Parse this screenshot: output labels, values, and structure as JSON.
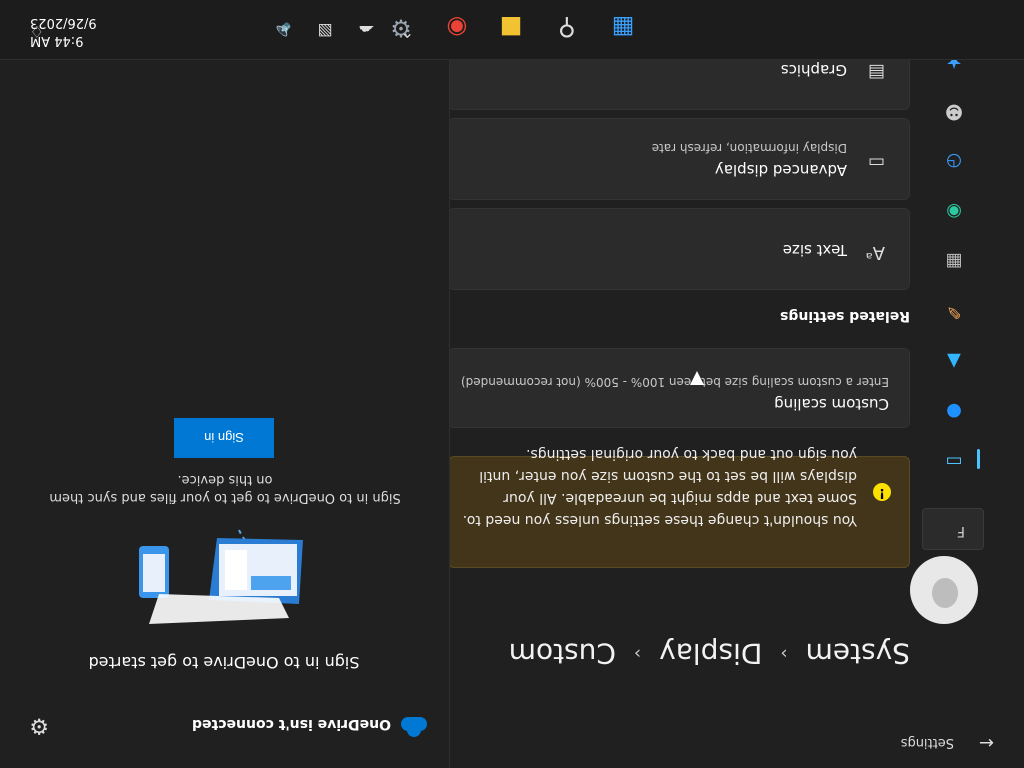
{
  "settings": {
    "window_title": "Settings",
    "back_icon": "back-arrow-icon",
    "find_label": "F",
    "breadcrumb": [
      "System",
      "Display",
      "Custom"
    ],
    "warning": "You shouldn't change these settings unless you need to. Some text and apps might be unreadable. All your displays will be set to the custom size you enter, until you sign out and back to your original settings.",
    "custom_scaling": {
      "title": "Custom scaling",
      "subtitle": "Enter a custom scaling size between 100% - 500% (not recommended)"
    },
    "related_settings": "Related settings",
    "related_items": [
      {
        "title": "Text size",
        "subtitle": "",
        "icon": "text-size-icon"
      },
      {
        "title": "Advanced display",
        "subtitle": "Display information, refresh rate",
        "icon": "monitor-icon"
      },
      {
        "title": "Graphics",
        "subtitle": "",
        "icon": "graphics-icon"
      }
    ]
  },
  "onedrive": {
    "status": "OneDrive isn't connected",
    "headline": "Sign in to OneDrive to get started",
    "body": "Sign in to OneDrive to get to your files and sync them on this device.",
    "sign_in": "Sign in"
  },
  "taskbar": {
    "time": "9:44 AM",
    "date": "9/26/2023"
  },
  "colors": {
    "accent": "#0078d4",
    "warning_bg": "#433519",
    "warning_icon": "#fce100",
    "nav_selected": "#4cc2ff"
  }
}
